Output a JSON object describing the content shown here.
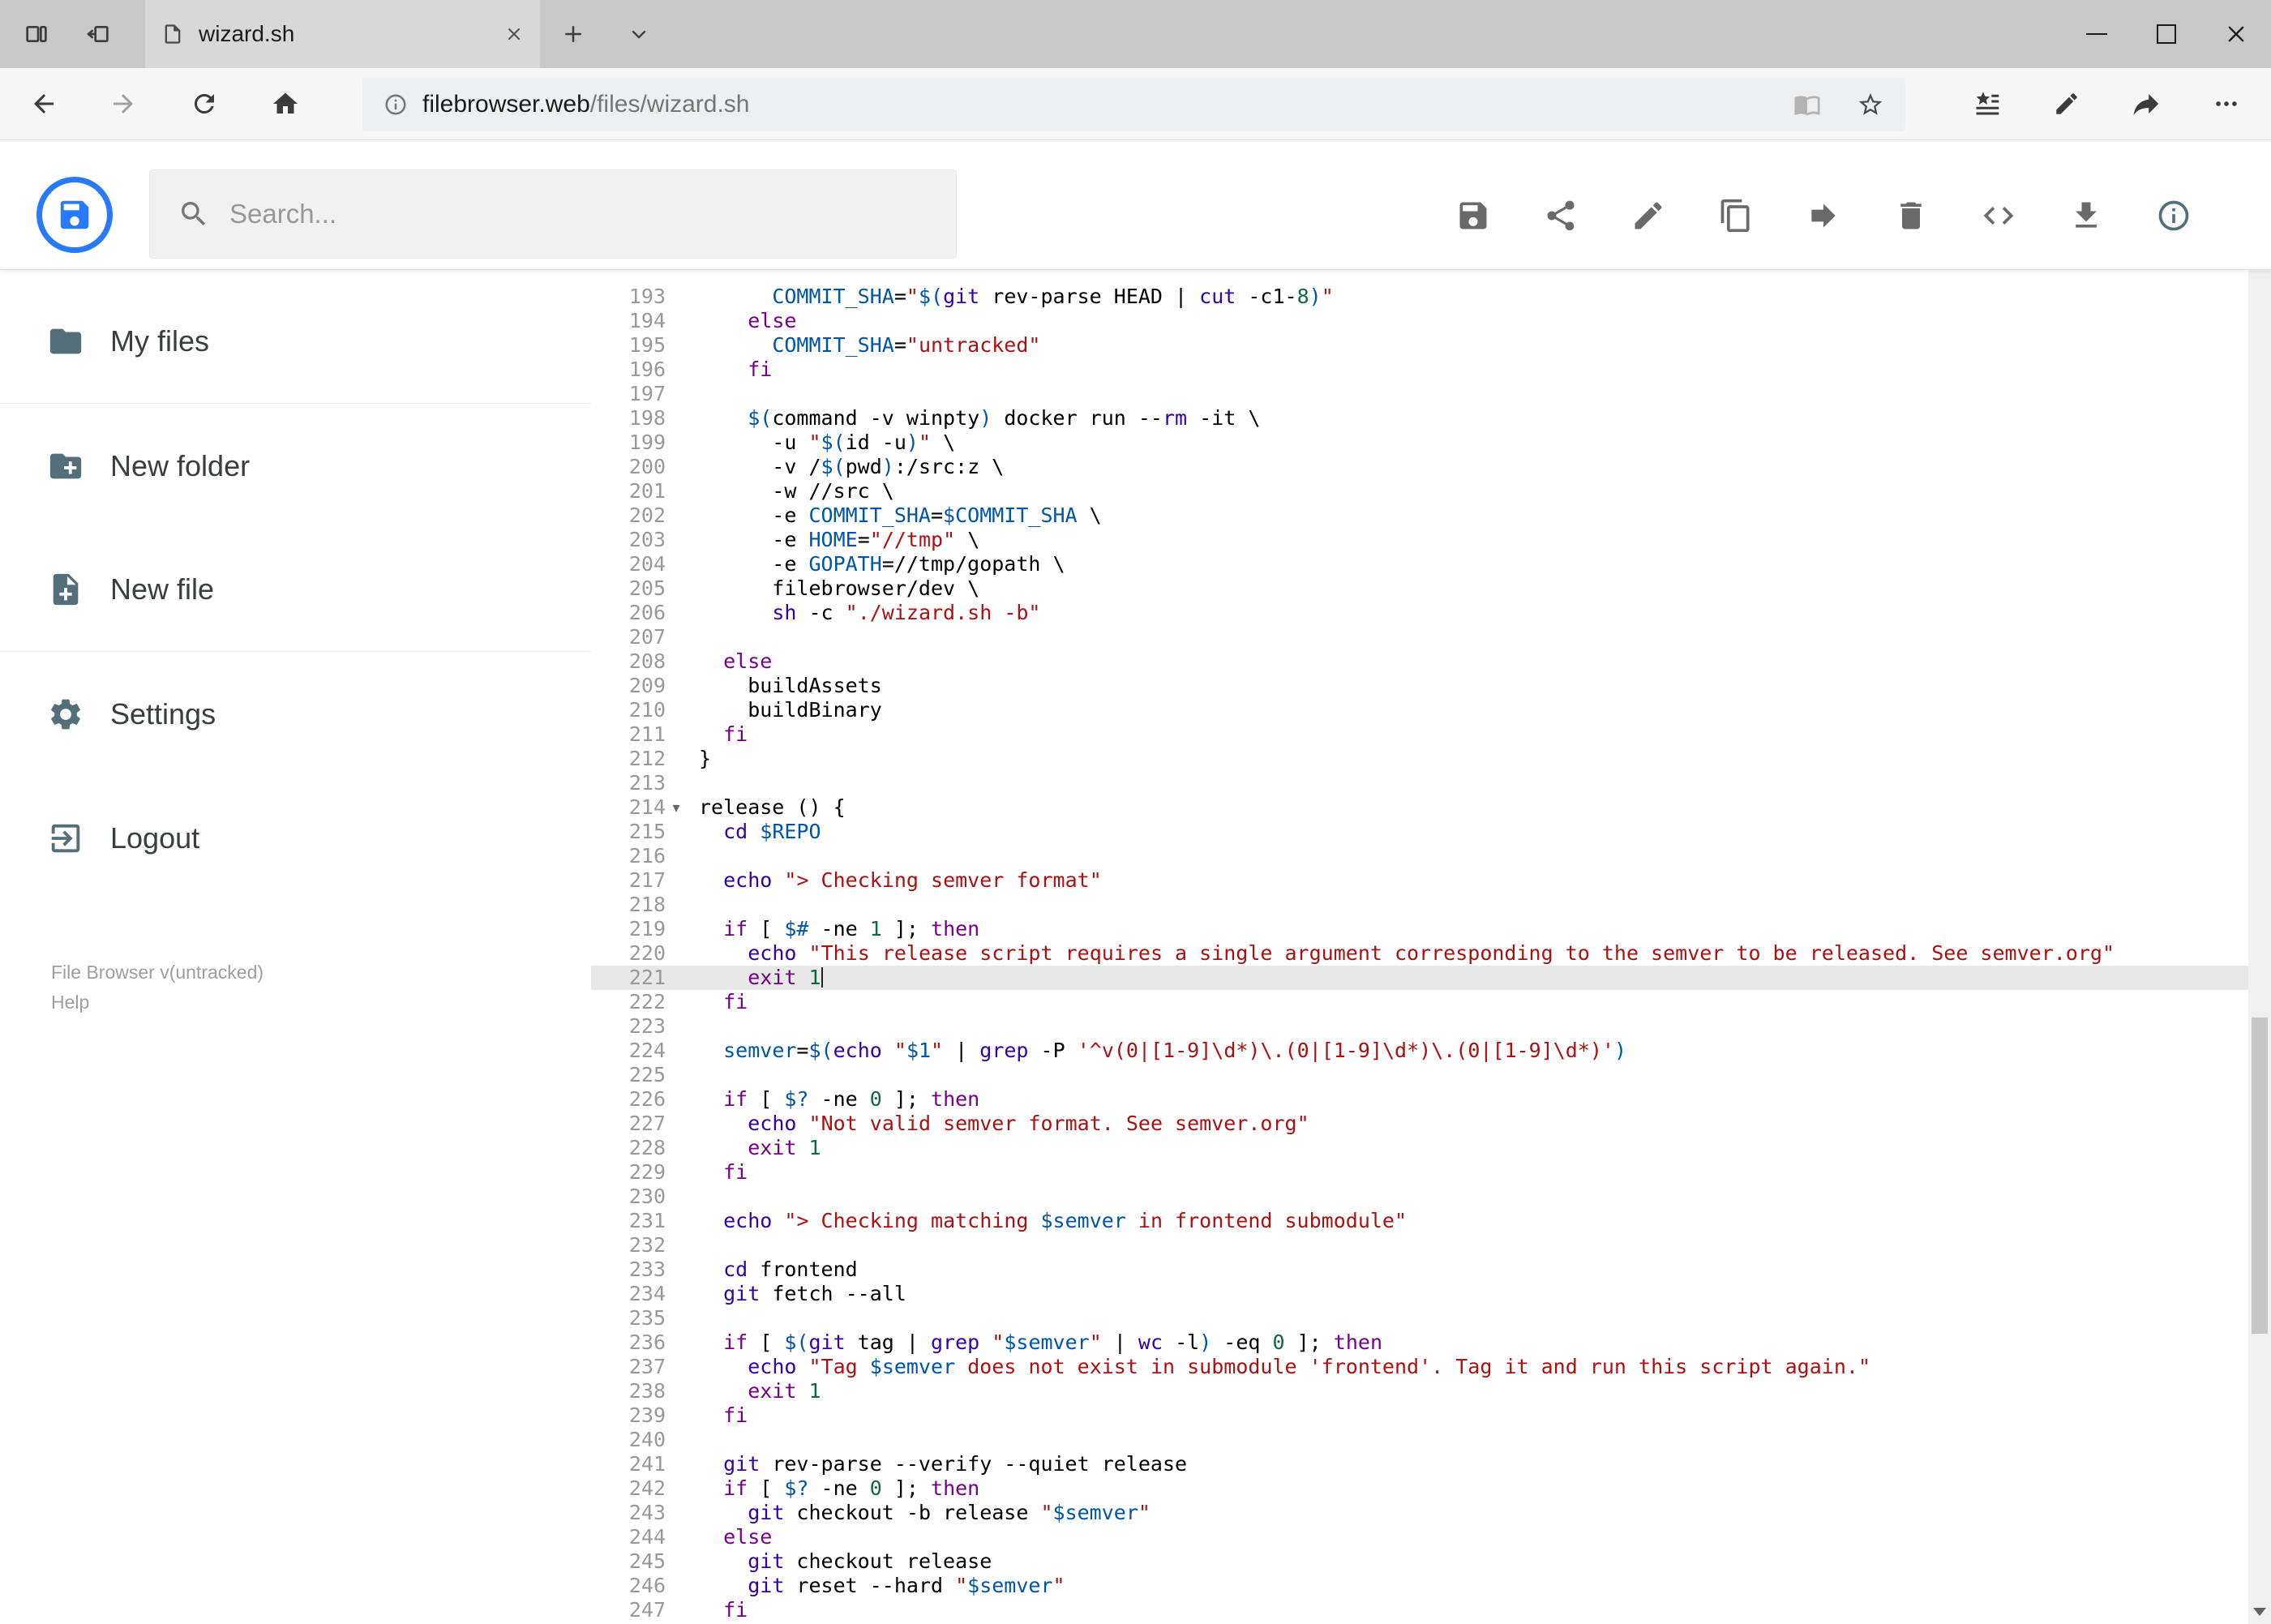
{
  "theme": {
    "accent_blue": "#2979ff",
    "active_line_bg": "#e8e8e8"
  },
  "window": {
    "tab_title": "wizard.sh",
    "tab_bar_icons": [
      "tab-cards",
      "set-tabs-aside",
      "page",
      "close-tab",
      "new-tab",
      "tab-preview-chevron"
    ],
    "control_icons": [
      "minimize",
      "maximize",
      "close"
    ]
  },
  "browser": {
    "url_domain": "filebrowser.web",
    "url_path": "/files/wizard.sh",
    "nav_icons": [
      "back",
      "forward",
      "refresh",
      "home"
    ],
    "address_icons": [
      "site-info",
      "reading-view",
      "favorite-star"
    ],
    "action_icons": [
      "favorites-hub",
      "web-note",
      "share",
      "more"
    ]
  },
  "app": {
    "search_placeholder": "Search...",
    "toolbar_icons": [
      "save",
      "share",
      "edit",
      "copy",
      "move",
      "delete",
      "code",
      "download",
      "info"
    ],
    "sidebar": {
      "items": [
        {
          "label": "My files",
          "icon": "folder"
        },
        {
          "label": "New folder",
          "icon": "new-folder"
        },
        {
          "label": "New file",
          "icon": "new-file"
        },
        {
          "label": "Settings",
          "icon": "settings"
        },
        {
          "label": "Logout",
          "icon": "logout"
        }
      ],
      "footer_version": "File Browser v(untracked)",
      "footer_help": "Help"
    }
  },
  "editor": {
    "first_line_number": 193,
    "active_line_number": 221,
    "fold_marker_line": 214,
    "cursor": {
      "line": 221,
      "col": 10
    },
    "colors": {
      "keyword": "#708",
      "builtin": "#30a",
      "string": "#a11",
      "variable": "#05a",
      "definition": "#05a",
      "number": "#164"
    },
    "lines": [
      "      COMMIT_SHA=\"$(git rev-parse HEAD | cut -c1-8)\"",
      "    else",
      "      COMMIT_SHA=\"untracked\"",
      "    fi",
      "",
      "    $(command -v winpty) docker run --rm -it \\",
      "      -u \"$(id -u)\" \\",
      "      -v /$(pwd):/src:z \\",
      "      -w //src \\",
      "      -e COMMIT_SHA=$COMMIT_SHA \\",
      "      -e HOME=\"//tmp\" \\",
      "      -e GOPATH=//tmp/gopath \\",
      "      filebrowser/dev \\",
      "      sh -c \"./wizard.sh -b\"",
      "",
      "  else",
      "    buildAssets",
      "    buildBinary",
      "  fi",
      "}",
      "",
      "release () {",
      "  cd $REPO",
      "",
      "  echo \"> Checking semver format\"",
      "",
      "  if [ $# -ne 1 ]; then",
      "    echo \"This release script requires a single argument corresponding to the semver to be released. See semver.org\"",
      "    exit 1",
      "  fi",
      "",
      "  semver=$(echo \"$1\" | grep -P '^v(0|[1-9]\\d*)\\.(0|[1-9]\\d*)\\.(0|[1-9]\\d*)')",
      "",
      "  if [ $? -ne 0 ]; then",
      "    echo \"Not valid semver format. See semver.org\"",
      "    exit 1",
      "  fi",
      "",
      "  echo \"> Checking matching $semver in frontend submodule\"",
      "",
      "  cd frontend",
      "  git fetch --all",
      "",
      "  if [ $(git tag | grep \"$semver\" | wc -l) -eq 0 ]; then",
      "    echo \"Tag $semver does not exist in submodule 'frontend'. Tag it and run this script again.\"",
      "    exit 1",
      "  fi",
      "",
      "  git rev-parse --verify --quiet release",
      "  if [ $? -ne 0 ]; then",
      "    git checkout -b release \"$semver\"",
      "  else",
      "    git checkout release",
      "    git reset --hard \"$semver\"",
      "  fi"
    ]
  }
}
